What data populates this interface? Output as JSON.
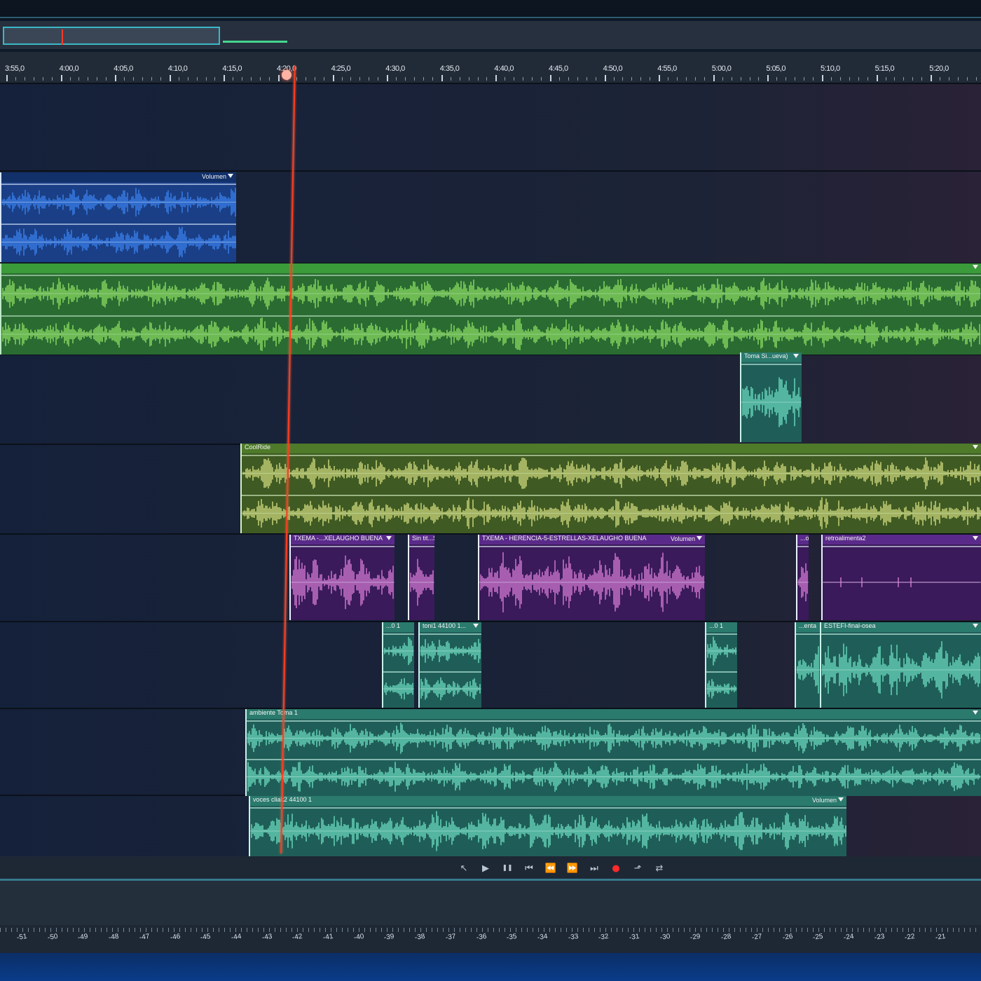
{
  "overview": {
    "label": "session-overview"
  },
  "ruler": {
    "ticks": [
      "3:55,0",
      "4:00,0",
      "4:05,0",
      "4:10,0",
      "4:15,0",
      "4:20,0",
      "4:25,0",
      "4:30,0",
      "4:35,0",
      "4:40,0",
      "4:45,0",
      "4:50,0",
      "4:55,0",
      "5:00,0",
      "5:05,0",
      "5:10,0",
      "5:15,0",
      "5:20,0"
    ]
  },
  "colors": {
    "blue": "#3f79e0",
    "green": "#2e8a3a",
    "teal": "#2a7e70",
    "lime": "#b8d66e",
    "purple": "#5a2a8a",
    "waveGreen": "#9cf06a",
    "waveTeal": "#78f0d0",
    "wavePink": "#f08ce8",
    "waveBlue": "#3f8cff",
    "playhead": "#ff3b1f"
  },
  "clips": [
    {
      "id": "c1",
      "label": "",
      "vol": "Volumen",
      "color": "blue"
    },
    {
      "id": "c2",
      "label": "",
      "vol": "",
      "color": "green"
    },
    {
      "id": "c3",
      "label": "Toma Si...ueva)",
      "vol": "",
      "color": "teal"
    },
    {
      "id": "c4",
      "label": "CoolRide",
      "vol": "",
      "color": "lime"
    },
    {
      "id": "c5",
      "label": "TXEMA -...XELAUGHO BUENA",
      "vol": "",
      "color": "purple"
    },
    {
      "id": "c6",
      "label": "Sin tit...S",
      "vol": "",
      "color": "purple"
    },
    {
      "id": "c7",
      "label": "TXEMA - HERENCIA-5-ESTRELLAS-XELAUGHO BUENA",
      "vol": "Volumen",
      "color": "purple"
    },
    {
      "id": "c8",
      "label": "...o",
      "vol": "",
      "color": "purple"
    },
    {
      "id": "c9",
      "label": "retroalimenta2",
      "vol": "",
      "color": "purple"
    },
    {
      "id": "c10",
      "label": "...0 1",
      "vol": "",
      "color": "teal"
    },
    {
      "id": "c11",
      "label": "toni1 44100 1...",
      "vol": "",
      "color": "teal"
    },
    {
      "id": "c12",
      "label": "...0 1",
      "vol": "",
      "color": "teal"
    },
    {
      "id": "c13",
      "label": "...enta",
      "vol": "",
      "color": "teal"
    },
    {
      "id": "c14",
      "label": "ESTEFI-final-osea",
      "vol": "",
      "color": "teal"
    },
    {
      "id": "c15",
      "label": "ambiente Toma 1",
      "vol": "",
      "color": "teal"
    },
    {
      "id": "c16",
      "label": "voces cliak2 44100 1",
      "vol": "Volumen",
      "color": "teal"
    }
  ],
  "transport": {
    "buttons": [
      "cursor-icon",
      "play-icon",
      "pause-icon",
      "skip-back-icon",
      "rewind-icon",
      "fast-forward-icon",
      "skip-forward-icon",
      "record-icon",
      "export-icon",
      "loop-icon"
    ]
  },
  "meter": {
    "labels": [
      "-51",
      "-50",
      "-49",
      "-48",
      "-47",
      "-46",
      "-45",
      "-44",
      "-43",
      "-42",
      "-41",
      "-40",
      "-39",
      "-38",
      "-37",
      "-36",
      "-35",
      "-34",
      "-33",
      "-32",
      "-31",
      "-30",
      "-29",
      "-28",
      "-27",
      "-26",
      "-25",
      "-24",
      "-23",
      "-22",
      "-21"
    ]
  }
}
